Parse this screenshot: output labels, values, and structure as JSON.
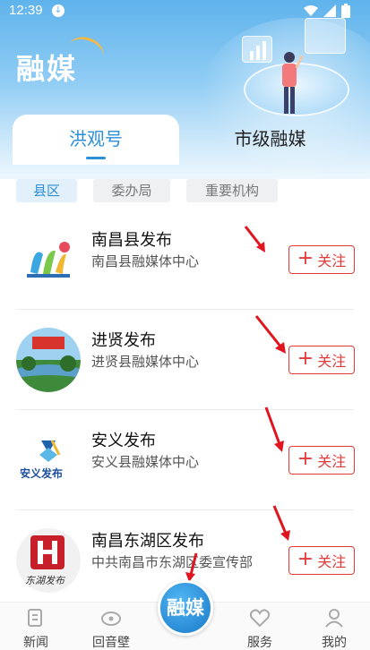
{
  "status_bar": {
    "time": "12:39"
  },
  "header": {
    "logo_text": "融媒"
  },
  "tabs": [
    {
      "label": "洪观号",
      "active": true
    },
    {
      "label": "市级融媒",
      "active": false
    }
  ],
  "filters": [
    {
      "label": "县区",
      "active": true
    },
    {
      "label": "委办局",
      "active": false
    },
    {
      "label": "重要机构",
      "active": false
    }
  ],
  "accounts": [
    {
      "name": "南昌县发布",
      "org": "南昌县融媒体中心",
      "follow_label": "关注",
      "avatar_icon": "nanchang-county-logo"
    },
    {
      "name": "进贤发布",
      "org": "进贤县融媒体中心",
      "follow_label": "关注",
      "avatar_icon": "jinxian-lake-photo"
    },
    {
      "name": "安义发布",
      "org": "安义县融媒体中心",
      "follow_label": "关注",
      "avatar_icon": "anyi-logo",
      "avatar_text": "安义发布"
    },
    {
      "name": "南昌东湖区发布",
      "org": "中共南昌市东湖区委宣传部",
      "follow_label": "关注",
      "avatar_icon": "donghu-logo",
      "avatar_text": "东湖发布"
    }
  ],
  "bottom_nav": [
    {
      "label": "新闻",
      "icon": "news-icon"
    },
    {
      "label": "回音壁",
      "icon": "echo-wall-icon"
    },
    {
      "label": "融媒",
      "icon": "rongmei-center-icon"
    },
    {
      "label": "服务",
      "icon": "heart-icon"
    },
    {
      "label": "我的",
      "icon": "profile-icon"
    }
  ],
  "colors": {
    "accent": "#2c8fd8",
    "follow": "#e23a3a",
    "annotation_arrow": "#e0151f"
  }
}
